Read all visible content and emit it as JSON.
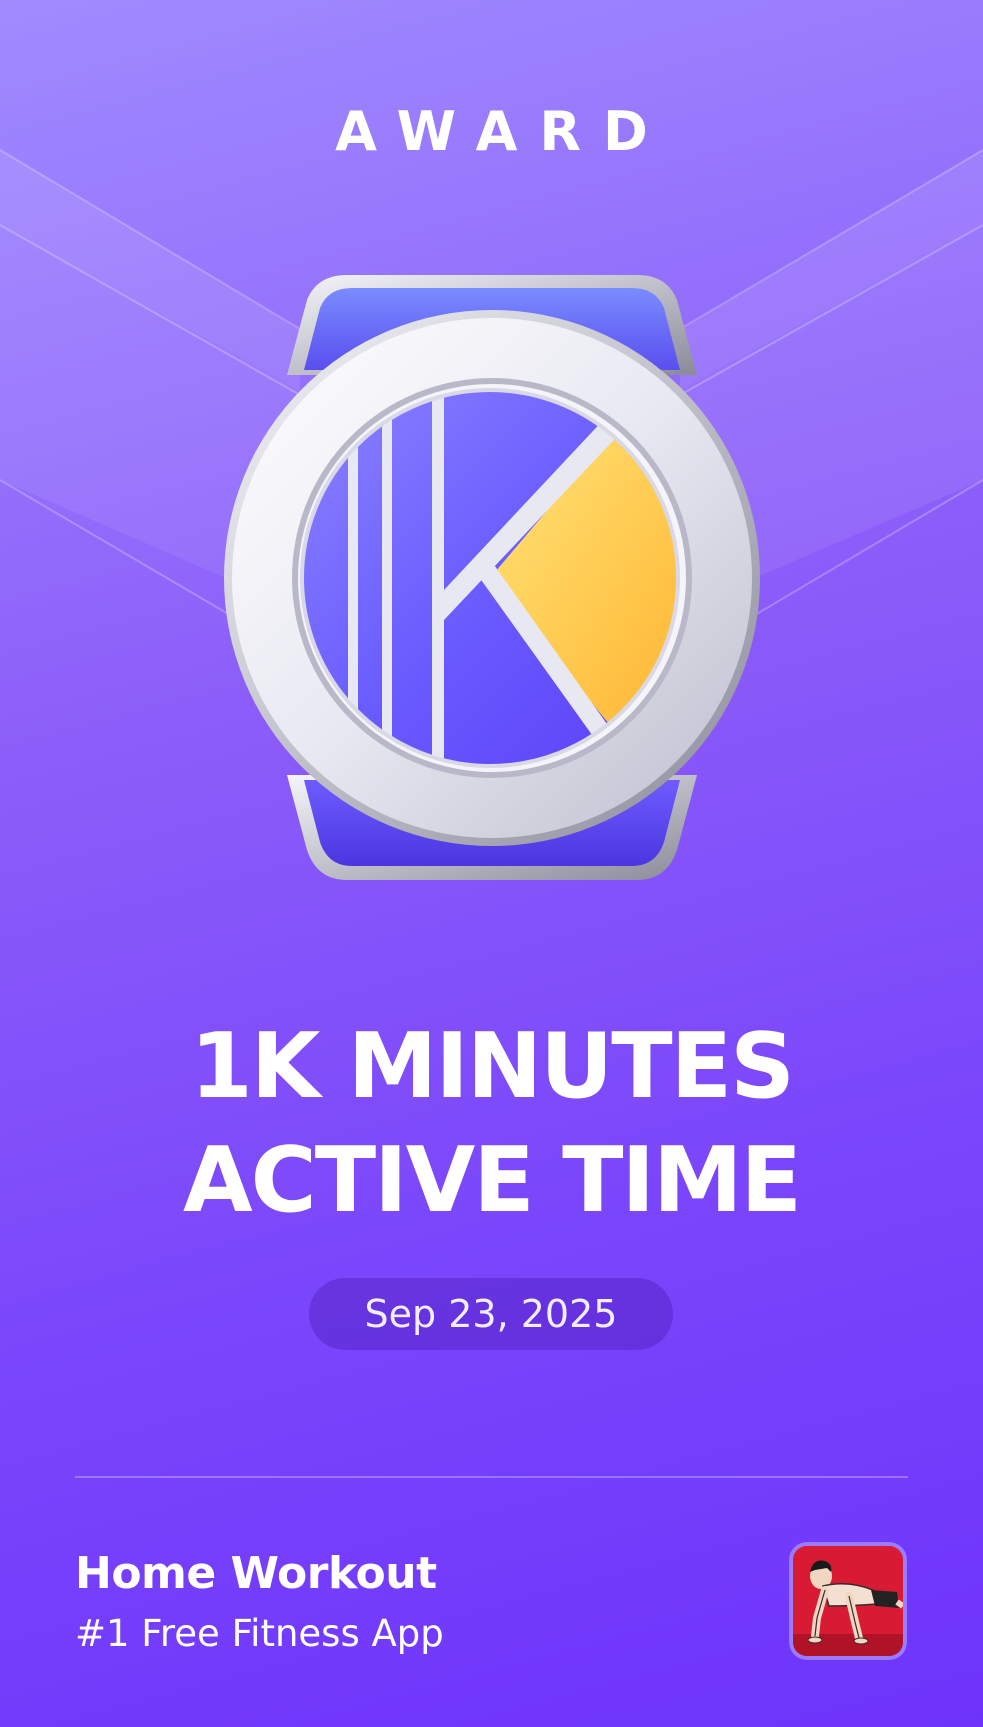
{
  "award": {
    "title": "AWARD"
  },
  "achievement": {
    "line1": "1K MINUTES",
    "line2": "ACTIVE TIME",
    "date": "Sep 23, 2025"
  },
  "footer": {
    "app_name": "Home Workout",
    "tagline": "#1 Free Fitness App",
    "app_icon": "pushup-man-icon"
  },
  "colors": {
    "background_top": "#a08bff",
    "background_bottom": "#6d33fb",
    "medal_blue": "#5b4cff",
    "medal_yellow": "#ffc23a",
    "app_icon_red": "#d81a33"
  }
}
